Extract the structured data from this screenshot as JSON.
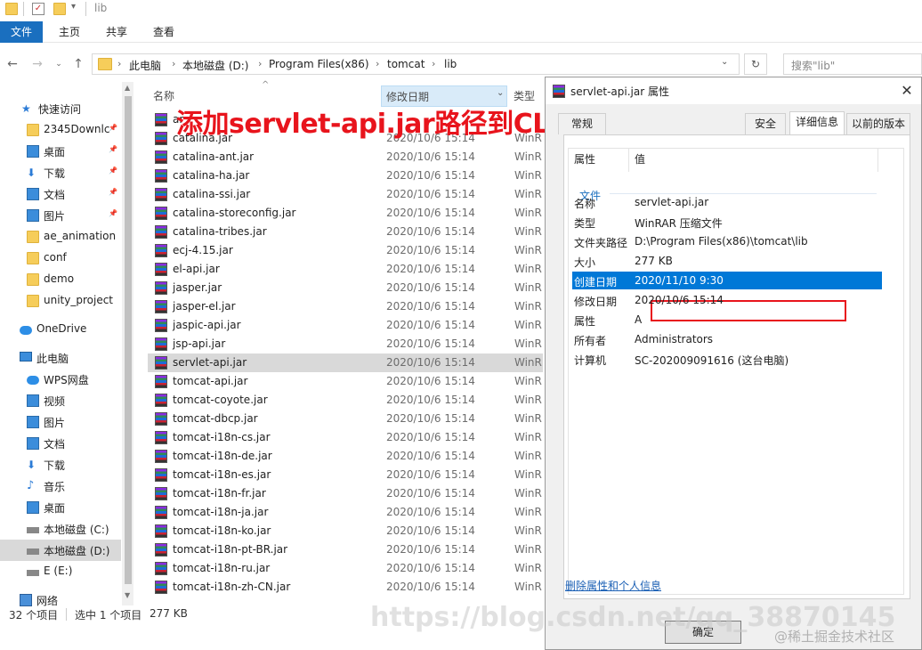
{
  "window": {
    "title": "lib",
    "ribbon_tabs": [
      "文件",
      "主页",
      "共享",
      "查看"
    ]
  },
  "address": {
    "crumbs": [
      "此电脑",
      "本地磁盘 (D:)",
      "Program Files(x86)",
      "tomcat",
      "lib"
    ],
    "search_placeholder": "搜索\"lib\""
  },
  "sidebar": {
    "items": [
      {
        "label": "快速访问",
        "icon": "star-icon"
      },
      {
        "label": "2345Downlc",
        "icon": "folder-icon",
        "pinned": true
      },
      {
        "label": "桌面",
        "icon": "desktop-icon",
        "pinned": true
      },
      {
        "label": "下载",
        "icon": "download-icon",
        "pinned": true
      },
      {
        "label": "文档",
        "icon": "document-icon",
        "pinned": true
      },
      {
        "label": "图片",
        "icon": "picture-icon",
        "pinned": true
      },
      {
        "label": "ae_animation",
        "icon": "folder-icon"
      },
      {
        "label": "conf",
        "icon": "folder-icon"
      },
      {
        "label": "demo",
        "icon": "folder-icon"
      },
      {
        "label": "unity_project",
        "icon": "folder-icon"
      },
      {
        "label": "OneDrive",
        "icon": "cloud-icon"
      },
      {
        "label": "此电脑",
        "icon": "computer-icon"
      },
      {
        "label": "WPS网盘",
        "icon": "cloud-icon"
      },
      {
        "label": "视频",
        "icon": "video-icon"
      },
      {
        "label": "图片",
        "icon": "picture-icon"
      },
      {
        "label": "文档",
        "icon": "document-icon"
      },
      {
        "label": "下载",
        "icon": "download-icon"
      },
      {
        "label": "音乐",
        "icon": "music-icon"
      },
      {
        "label": "桌面",
        "icon": "desktop-icon"
      },
      {
        "label": "本地磁盘 (C:)",
        "icon": "drive-icon"
      },
      {
        "label": "本地磁盘 (D:)",
        "icon": "drive-icon",
        "selected": true
      },
      {
        "label": "E (E:)",
        "icon": "drive-icon"
      },
      {
        "label": "网络",
        "icon": "network-icon"
      }
    ]
  },
  "filelist": {
    "headers": {
      "name": "名称",
      "date": "修改日期",
      "type": "类型"
    },
    "files": [
      {
        "name": "ar",
        "date": "",
        "type": ""
      },
      {
        "name": "catalina.jar",
        "date": "2020/10/6 15:14",
        "type": "WinR"
      },
      {
        "name": "catalina-ant.jar",
        "date": "2020/10/6 15:14",
        "type": "WinR"
      },
      {
        "name": "catalina-ha.jar",
        "date": "2020/10/6 15:14",
        "type": "WinR"
      },
      {
        "name": "catalina-ssi.jar",
        "date": "2020/10/6 15:14",
        "type": "WinR"
      },
      {
        "name": "catalina-storeconfig.jar",
        "date": "2020/10/6 15:14",
        "type": "WinR"
      },
      {
        "name": "catalina-tribes.jar",
        "date": "2020/10/6 15:14",
        "type": "WinR"
      },
      {
        "name": "ecj-4.15.jar",
        "date": "2020/10/6 15:14",
        "type": "WinR"
      },
      {
        "name": "el-api.jar",
        "date": "2020/10/6 15:14",
        "type": "WinR"
      },
      {
        "name": "jasper.jar",
        "date": "2020/10/6 15:14",
        "type": "WinR"
      },
      {
        "name": "jasper-el.jar",
        "date": "2020/10/6 15:14",
        "type": "WinR"
      },
      {
        "name": "jaspic-api.jar",
        "date": "2020/10/6 15:14",
        "type": "WinR"
      },
      {
        "name": "jsp-api.jar",
        "date": "2020/10/6 15:14",
        "type": "WinR"
      },
      {
        "name": "servlet-api.jar",
        "date": "2020/10/6 15:14",
        "type": "WinR",
        "selected": true
      },
      {
        "name": "tomcat-api.jar",
        "date": "2020/10/6 15:14",
        "type": "WinR"
      },
      {
        "name": "tomcat-coyote.jar",
        "date": "2020/10/6 15:14",
        "type": "WinR"
      },
      {
        "name": "tomcat-dbcp.jar",
        "date": "2020/10/6 15:14",
        "type": "WinR"
      },
      {
        "name": "tomcat-i18n-cs.jar",
        "date": "2020/10/6 15:14",
        "type": "WinR"
      },
      {
        "name": "tomcat-i18n-de.jar",
        "date": "2020/10/6 15:14",
        "type": "WinR"
      },
      {
        "name": "tomcat-i18n-es.jar",
        "date": "2020/10/6 15:14",
        "type": "WinR"
      },
      {
        "name": "tomcat-i18n-fr.jar",
        "date": "2020/10/6 15:14",
        "type": "WinR"
      },
      {
        "name": "tomcat-i18n-ja.jar",
        "date": "2020/10/6 15:14",
        "type": "WinR"
      },
      {
        "name": "tomcat-i18n-ko.jar",
        "date": "2020/10/6 15:14",
        "type": "WinR"
      },
      {
        "name": "tomcat-i18n-pt-BR.jar",
        "date": "2020/10/6 15:14",
        "type": "WinR"
      },
      {
        "name": "tomcat-i18n-ru.jar",
        "date": "2020/10/6 15:14",
        "type": "WinR"
      },
      {
        "name": "tomcat-i18n-zh-CN.jar",
        "date": "2020/10/6 15:14",
        "type": "WinR"
      }
    ]
  },
  "status": {
    "count": "32 个项目",
    "selected": "选中 1 个项目",
    "size": "277 KB"
  },
  "annotation": "添加servlet-api.jar路径到CLASSPATH",
  "dialog": {
    "title": "servlet-api.jar 属性",
    "tabs": [
      "常规",
      "安全",
      "详细信息",
      "以前的版本"
    ],
    "active_tab": "详细信息",
    "col_property": "属性",
    "col_value": "值",
    "group": "文件",
    "rows": [
      {
        "key": "名称",
        "value": "servlet-api.jar"
      },
      {
        "key": "类型",
        "value": "WinRAR 压缩文件"
      },
      {
        "key": "文件夹路径",
        "value": "D:\\Program Files(x86)\\tomcat\\lib"
      },
      {
        "key": "大小",
        "value": "277 KB"
      },
      {
        "key": "创建日期",
        "value": "2020/11/10 9:30",
        "highlighted": true
      },
      {
        "key": "修改日期",
        "value": "2020/10/6 15:14"
      },
      {
        "key": "属性",
        "value": "A"
      },
      {
        "key": "所有者",
        "value": "Administrators"
      },
      {
        "key": "计算机",
        "value": "SC-202009091616 (这台电脑)"
      }
    ],
    "remove_link": "删除属性和个人信息",
    "ok": "确定"
  },
  "watermarks": {
    "url": "https://blog.csdn.net/qq_38870145",
    "community": "@稀土掘金技术社区"
  },
  "colors": {
    "accent": "#0078d7",
    "annotation": "#e8141c",
    "ribbon_file": "#1a6fbf"
  }
}
